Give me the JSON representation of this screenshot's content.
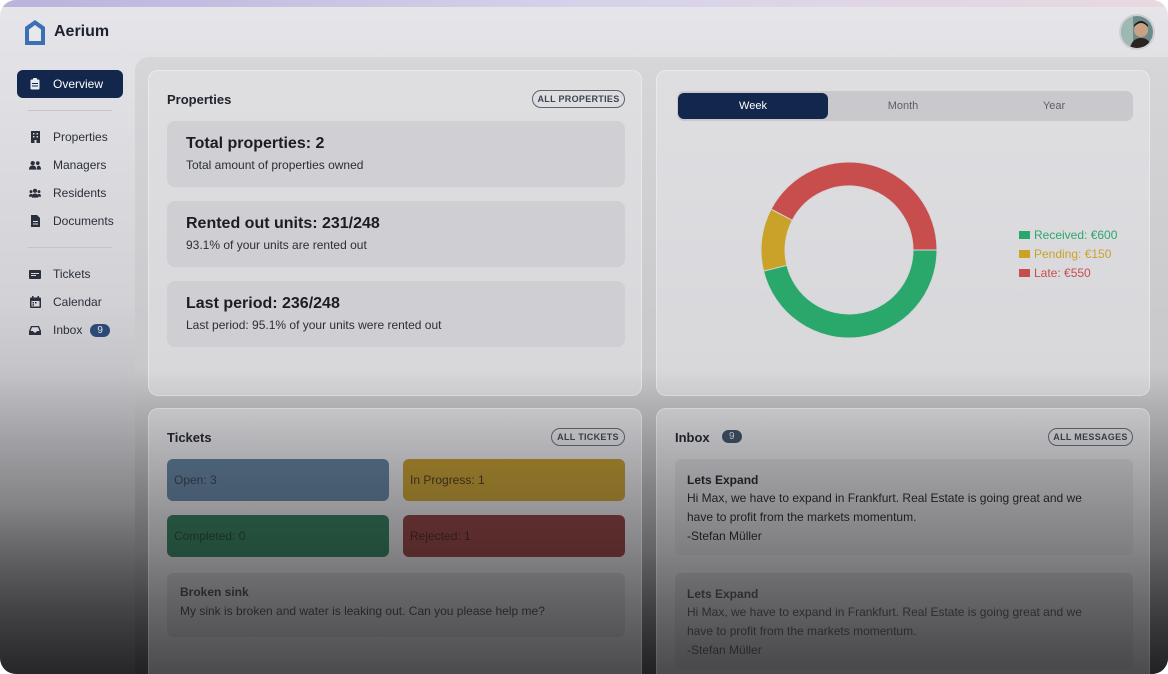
{
  "app": {
    "name": "Aerium"
  },
  "colors": {
    "navy": "#13264b",
    "received": "#2aa86b",
    "pending": "#c9a227",
    "late": "#c84e4e"
  },
  "sidebar": {
    "items": [
      {
        "label": "Overview",
        "icon": "clipboard-icon",
        "active": true
      },
      {
        "label": "Properties",
        "icon": "building-icon"
      },
      {
        "label": "Managers",
        "icon": "users-icon"
      },
      {
        "label": "Residents",
        "icon": "group-icon"
      },
      {
        "label": "Documents",
        "icon": "document-icon"
      },
      {
        "label": "Tickets",
        "icon": "ticket-icon"
      },
      {
        "label": "Calendar",
        "icon": "calendar-icon"
      },
      {
        "label": "Inbox",
        "icon": "inbox-icon",
        "badge": "9"
      }
    ]
  },
  "properties": {
    "title": "Properties",
    "button": "ALL PROPERTIES",
    "stats": [
      {
        "big": "Total properties: 2",
        "small": "Total amount of properties owned"
      },
      {
        "big": "Rented out units: 231/248",
        "small": "93.1% of your units are rented out"
      },
      {
        "big": "Last period: 236/248",
        "small": "Last period: 95.1% of your units were rented out"
      }
    ]
  },
  "payments": {
    "tabs": [
      "Week",
      "Month",
      "Year"
    ],
    "active_tab": "Week",
    "legend": [
      "Received: €600",
      "Pending: €150",
      "Late: €550"
    ]
  },
  "chart_data": {
    "type": "pie",
    "categories": [
      "Received",
      "Pending",
      "Late"
    ],
    "values": [
      600,
      150,
      550
    ],
    "colors": [
      "#2aa86b",
      "#c9a227",
      "#c84e4e"
    ],
    "legend_position": "right"
  },
  "tickets": {
    "title": "Tickets",
    "button": "ALL TICKETS",
    "status": [
      {
        "label": "Open: 3",
        "color": "#4d6f8f"
      },
      {
        "label": "In Progress: 1",
        "color": "#b8952f"
      },
      {
        "label": "Completed: 0",
        "color": "#2f7a58"
      },
      {
        "label": "Rejected: 1",
        "color": "#8b3b3b"
      }
    ],
    "items": [
      {
        "title": "Broken sink",
        "body": "My sink is broken and water is leaking out. Can you please help me?"
      }
    ]
  },
  "inbox": {
    "title": "Inbox",
    "badge": "9",
    "button": "ALL MESSAGES",
    "messages": [
      {
        "subject": "Lets Expand",
        "line1": "Hi Max, we have to expand in Frankfurt. Real Estate is going great and we",
        "line2": "have to profit from the markets momentum.",
        "sign": "-Stefan Müller"
      },
      {
        "subject": "Lets Expand",
        "line1": "Hi Max, we have to expand in Frankfurt. Real Estate is going great and we",
        "line2": "have to profit from the markets momentum.",
        "sign": "-Stefan Müller"
      }
    ]
  }
}
